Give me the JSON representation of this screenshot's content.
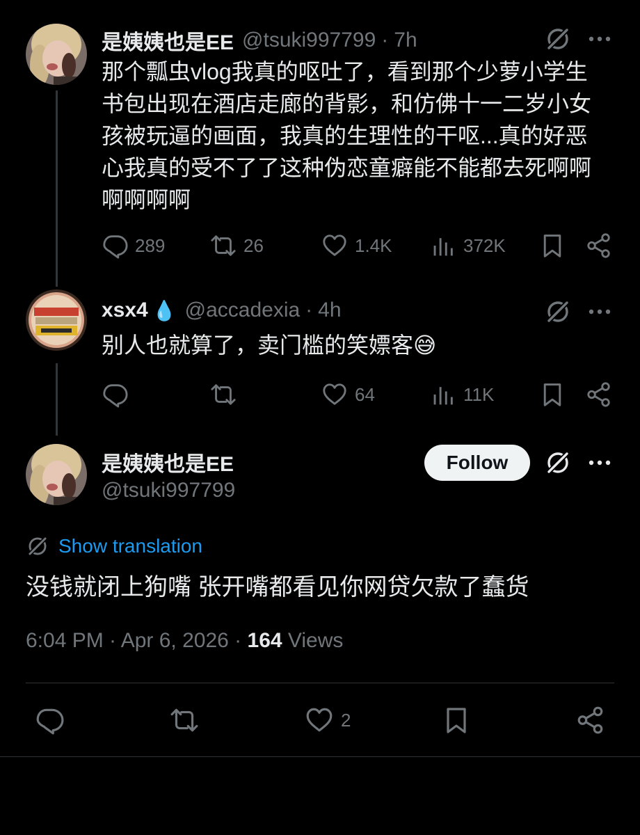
{
  "tweet1": {
    "display_name": "是姨姨也是EE",
    "handle": "@tsuki997799",
    "time": "7h",
    "lines": [
      "那个瓢虫vlog我真的呕吐了，看到那个少萝小学生",
      "书包出现在酒店走廊的背影，和仿佛十一二岁小女",
      "孩被玩逼的画面，我真的生理性的干呕...真的好恶",
      "心我真的受不了了这种伪恋童癖能不能都去死啊啊",
      "啊啊啊啊"
    ],
    "replies": "289",
    "reposts": "26",
    "likes": "1.4K",
    "views": "372K"
  },
  "tweet2": {
    "display_name": "xsx4",
    "name_emoji": "💧",
    "handle": "@accadexia",
    "time": "4h",
    "text": "别人也就算了，卖门槛的笑嫖客",
    "emoji": "😅",
    "likes": "64",
    "views": "11K"
  },
  "main_tweet": {
    "display_name": "是姨姨也是EE",
    "handle": "@tsuki997799",
    "follow_label": "Follow",
    "translation_label": "Show translation",
    "text": "没钱就闭上狗嘴 张开嘴都看见你网贷欠款了蠢货",
    "time_date": "6:04 PM · Apr 6, 2026 · ",
    "view_count": "164",
    "views_label": " Views",
    "likes": "2"
  },
  "separator": "·",
  "colors": {
    "background": "#000000",
    "text": "#e7e9ea",
    "muted": "#71767b",
    "link": "#1d9bf0",
    "follow_bg": "#eff3f4"
  }
}
